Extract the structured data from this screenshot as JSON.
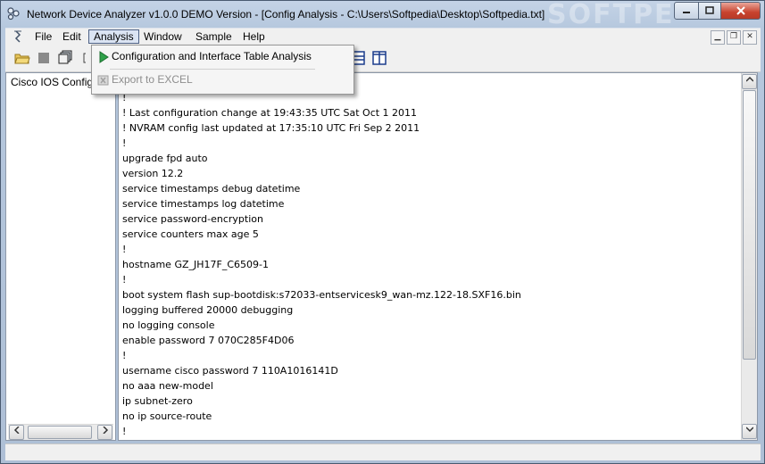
{
  "window": {
    "title": "Network Device Analyzer v1.0.0 DEMO Version - [Config Analysis - C:\\Users\\Softpedia\\Desktop\\Softpedia.txt]",
    "watermark": "SOFTPE"
  },
  "menubar": {
    "items": [
      "File",
      "Edit",
      "Analysis",
      "Window",
      "Sample",
      "Help"
    ]
  },
  "dropdown": {
    "items": [
      {
        "label": "Configuration and Interface Table Analysis",
        "enabled": true,
        "icon": "play-icon"
      },
      {
        "label": "Export to EXCEL",
        "enabled": false,
        "icon": "excel-icon"
      }
    ]
  },
  "left_panel": {
    "items": [
      "Cisco IOS Configu"
    ]
  },
  "config": {
    "lines": [
      "!",
      "! Last configuration change at 19:43:35 UTC Sat Oct 1 2011",
      "! NVRAM config last updated at 17:35:10 UTC Fri Sep 2 2011",
      "!",
      "upgrade fpd auto",
      "version 12.2",
      "service timestamps debug datetime",
      "service timestamps log datetime",
      "service password-encryption",
      "service counters max age 5",
      "!",
      "hostname GZ_JH17F_C6509-1",
      "!",
      "boot system flash sup-bootdisk:s72033-entservicesk9_wan-mz.122-18.SXF16.bin",
      "logging buffered 20000 debugging",
      "no logging console",
      "enable password 7 070C285F4D06",
      "!",
      "username cisco password 7 110A1016141D",
      "no aaa new-model",
      "ip subnet-zero",
      "no ip source-route",
      "!"
    ]
  },
  "colors": {
    "titlebar": "#b6c8de",
    "close_button": "#c8432e",
    "menu_highlight": "#dbe4f3"
  }
}
